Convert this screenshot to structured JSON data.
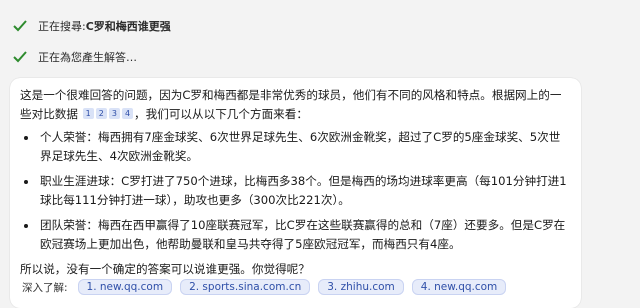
{
  "status": {
    "searching_prefix": "正在搜尋: ",
    "searching_query": "C罗和梅西谁更强",
    "generating": "正在為您產生解答…"
  },
  "answer": {
    "intro_part1": "这是一个很难回答的问题，因为C罗和梅西都是非常优秀的球员，他们有不同的风格和特点。根据网上的一些对比数据",
    "citations": [
      "1",
      "2",
      "3",
      "4"
    ],
    "intro_part2": "，我们可以从以下几个方面来看：",
    "points": [
      "个人荣誉：梅西拥有7座金球奖、6次世界足球先生、6次欧洲金靴奖，超过了C罗的5座金球奖、5次世界足球先生、4次欧洲金靴奖。",
      "职业生涯进球：C罗打进了750个进球，比梅西多38个。但是梅西的场均进球率更高（每101分钟打进1球比每111分钟打进一球），助攻也更多（300次比221次）。",
      "团队荣誉：梅西在西甲赢得了10座联赛冠军，比C罗在这些联赛赢得的总和（7座）还要多。但是C罗在欧冠赛场上更加出色，他帮助曼联和皇马共夺得了5座欧冠冠军，而梅西只有4座。"
    ],
    "closing": "所以说，没有一个确定的答案可以说谁更强。你觉得呢？"
  },
  "learn_more": {
    "label": "深入了解:",
    "links": [
      "1. new.qq.com",
      "2. sports.sina.com.cn",
      "3. zhihu.com",
      "4. new.qq.com"
    ]
  },
  "colors": {
    "check": "#2e8b2e",
    "link_bg": "#e7ecfa",
    "link_text": "#2f4fa8"
  },
  "icons": [
    "checkmark-icon"
  ]
}
